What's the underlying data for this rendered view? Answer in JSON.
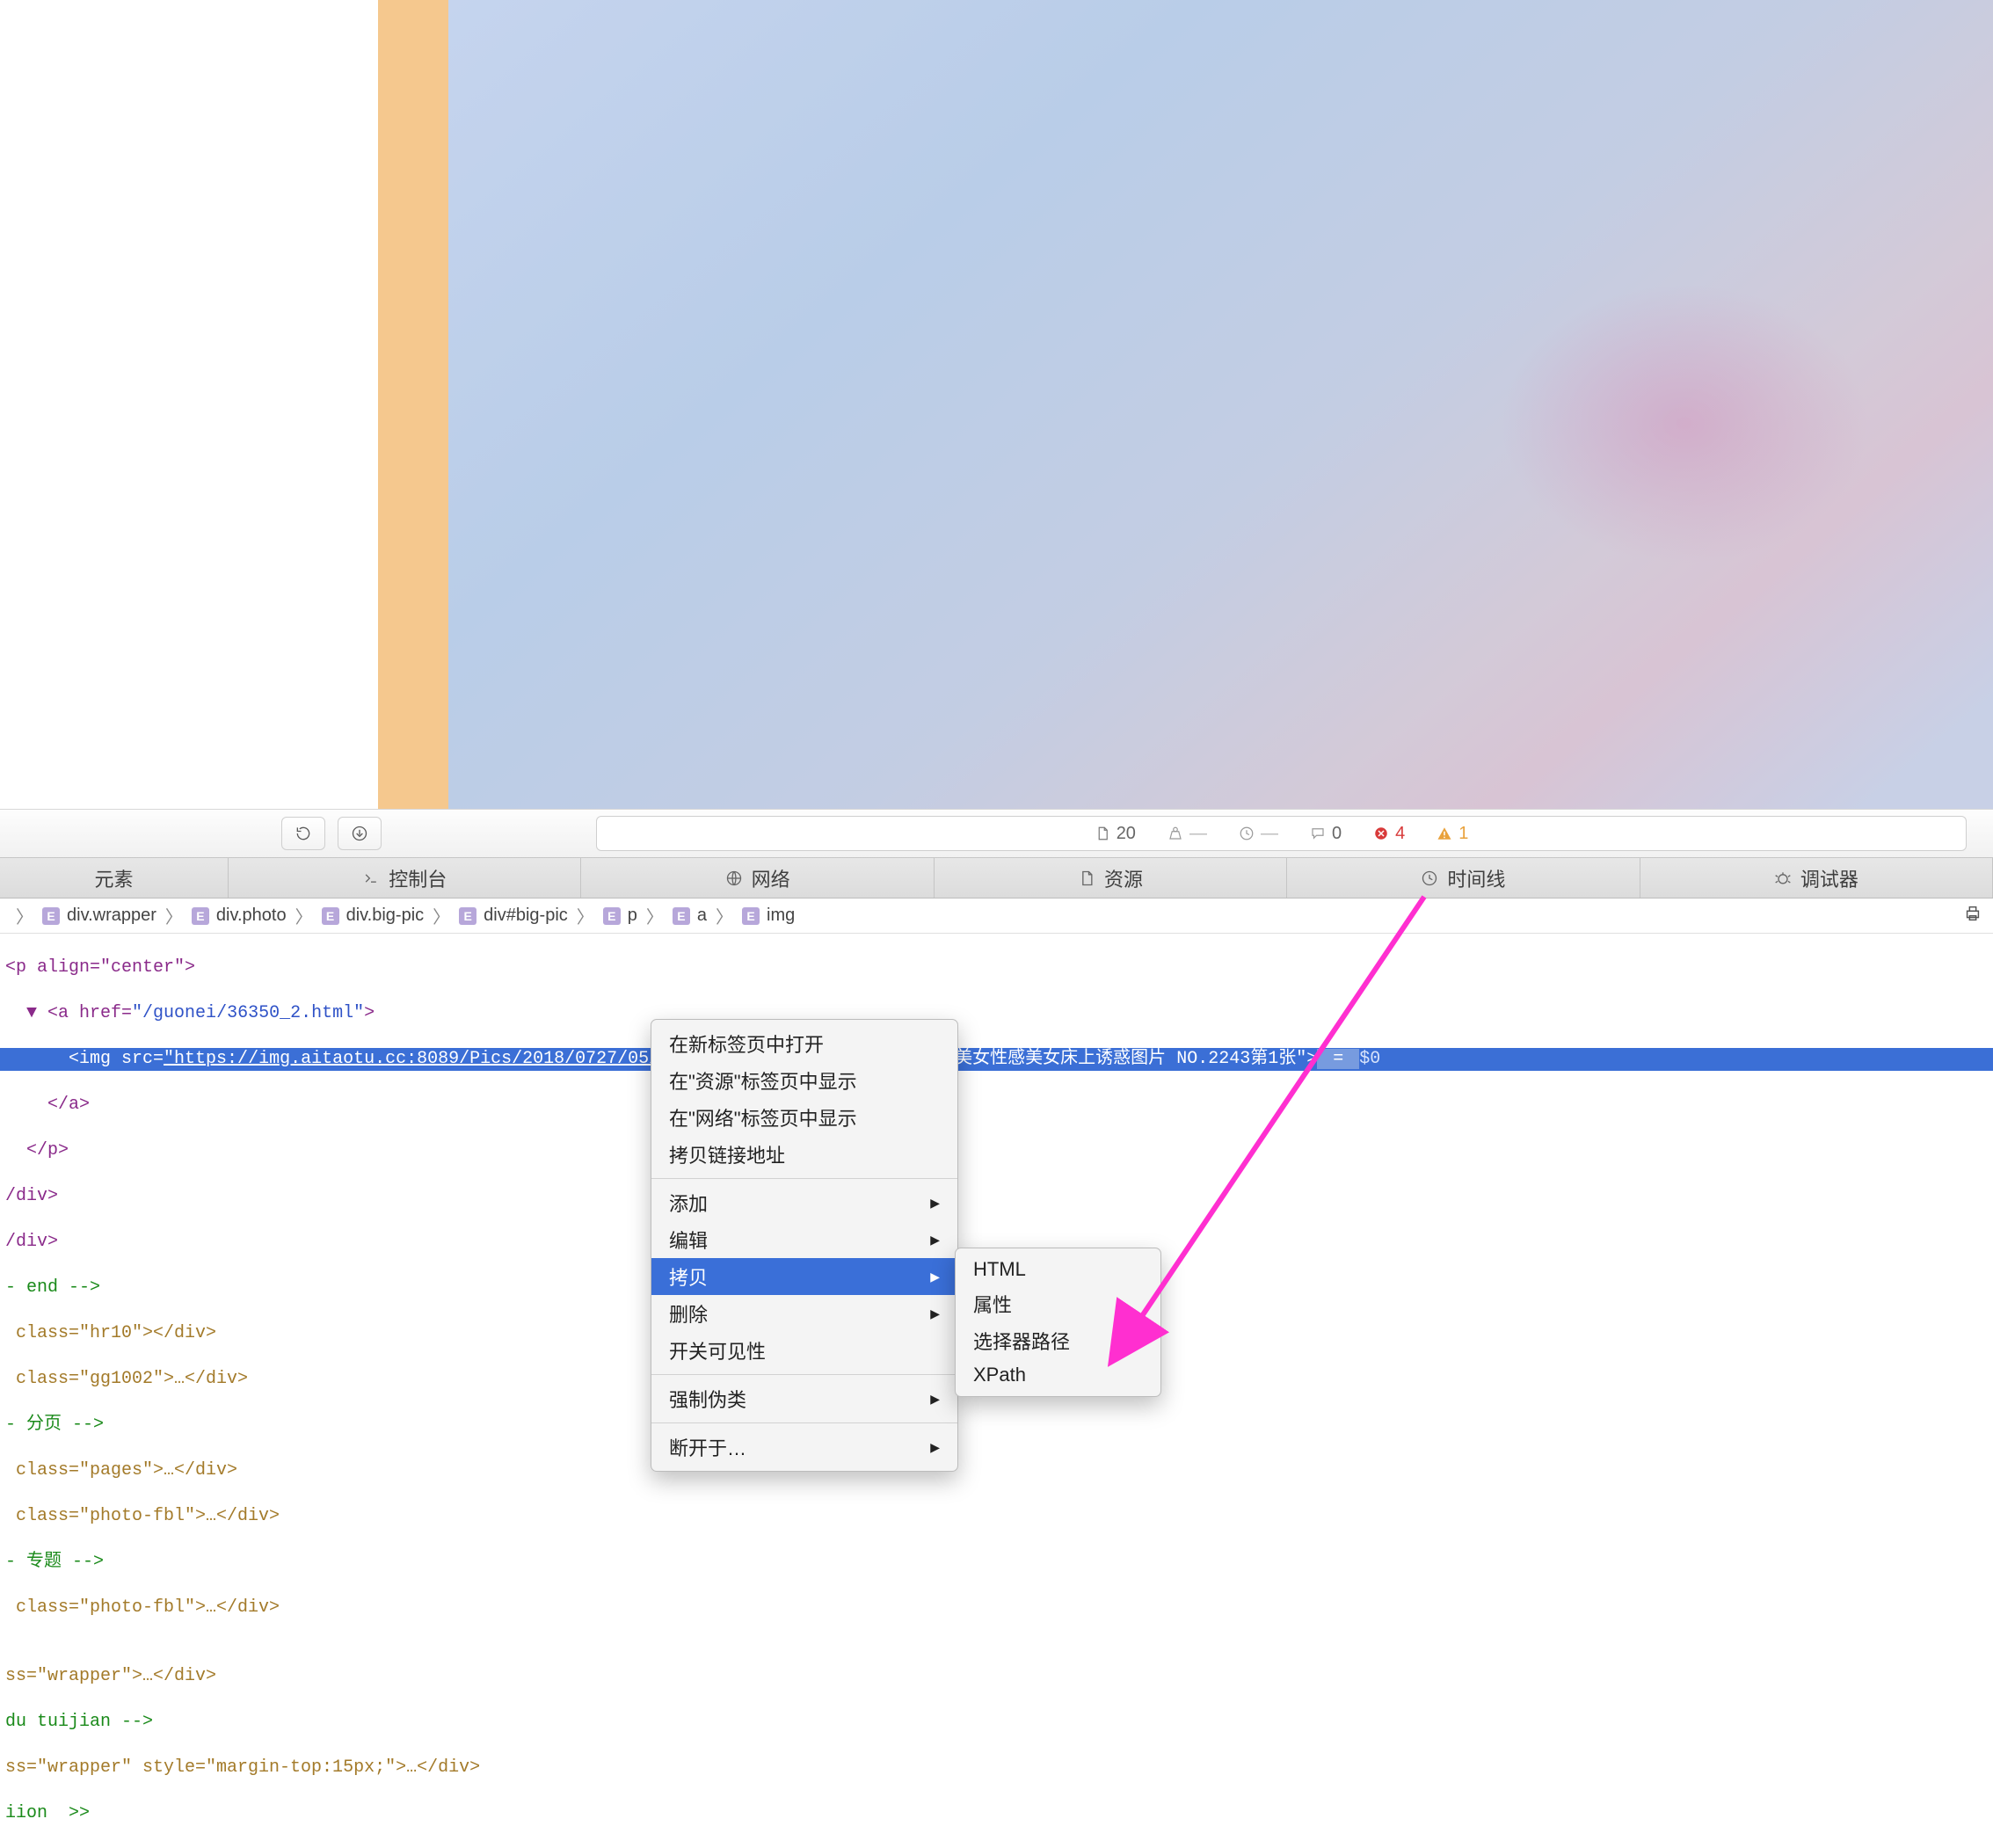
{
  "toolbar": {
    "doc_count": "20",
    "comments": "0",
    "errors": "4",
    "warnings": "1"
  },
  "tabs": {
    "elements": "元素",
    "console": "控制台",
    "network": "网络",
    "resources": "资源",
    "timeline": "时间线",
    "debugger": "调试器"
  },
  "breadcrumb": [
    "div.wrapper",
    "div.photo",
    "div.big-pic",
    "div#big-pic",
    "p",
    "a",
    "img"
  ],
  "dom": {
    "p_open": "<p align=\"center\">",
    "a_open_prefix": "▼ <a href=",
    "a_href": "\"/guonei/36350_2.html\"",
    "a_open_suffix": ">",
    "img_prefix": "<img src=",
    "img_src": "\"https://img.aitaotu.cc:8089/Pics/2018/0727/05/01.jpg\"",
    "img_mid": " alt=\"[ROSI写真]  90后美女性感美女床上诱惑图片 NO.2243第1张\">",
    "eq": " = ",
    "zero": "$0",
    "a_close": "</a>",
    "p_close": "</p>",
    "div_close1": "/div>",
    "div_close2": "/div>",
    "cmnt_end": "- end -->",
    "hr10": " class=\"hr10\"></div>",
    "gg1002": " class=\"gg1002\">…</div>",
    "cmnt_page": "- 分页 -->",
    "pages": " class=\"pages\">…</div>",
    "fbl1": " class=\"photo-fbl\">…</div>",
    "cmnt_topic": "- 专题 -->",
    "fbl2": " class=\"photo-fbl\">…</div>",
    "blank": "",
    "wrap1": "ss=\"wrapper\">…</div>",
    "cmnt_du": "du tuijian -->",
    "wrap2": "ss=\"wrapper\" style=\"margin-top:15px;\">…</div>",
    "iian": "iion  >>"
  },
  "context_menu": {
    "open_new_tab": "在新标签页中打开",
    "show_in_resources": "在\"资源\"标签页中显示",
    "show_in_network": "在\"网络\"标签页中显示",
    "copy_link": "拷贝链接地址",
    "add": "添加",
    "edit": "编辑",
    "copy": "拷贝",
    "delete": "删除",
    "toggle_visibility": "开关可见性",
    "force_pseudo": "强制伪类",
    "break_on": "断开于…"
  },
  "submenu": {
    "html": "HTML",
    "attributes": "属性",
    "selector_path": "选择器路径",
    "xpath": "XPath"
  }
}
